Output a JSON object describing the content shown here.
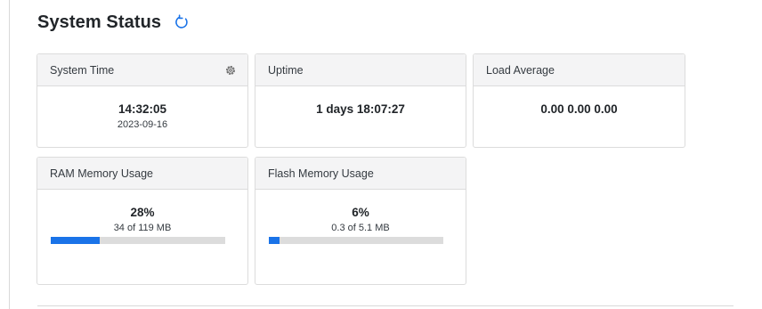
{
  "header": {
    "title": "System Status",
    "refresh_icon": "refresh-icon",
    "accent_color": "#1a73e8"
  },
  "cards": {
    "system_time": {
      "title": "System Time",
      "settings_icon": "gear-icon",
      "time": "14:32:05",
      "date": "2023-09-16"
    },
    "uptime": {
      "title": "Uptime",
      "value": "1 days 18:07:27"
    },
    "load_average": {
      "title": "Load Average",
      "value": "0.00 0.00 0.00"
    },
    "ram": {
      "title": "RAM Memory Usage",
      "percent": "28%",
      "detail": "34 of 119 MB",
      "usage_fraction": 0.28
    },
    "flash": {
      "title": "Flash Memory Usage",
      "percent": "6%",
      "detail": "0.3 of 5.1 MB",
      "usage_fraction": 0.06
    }
  }
}
